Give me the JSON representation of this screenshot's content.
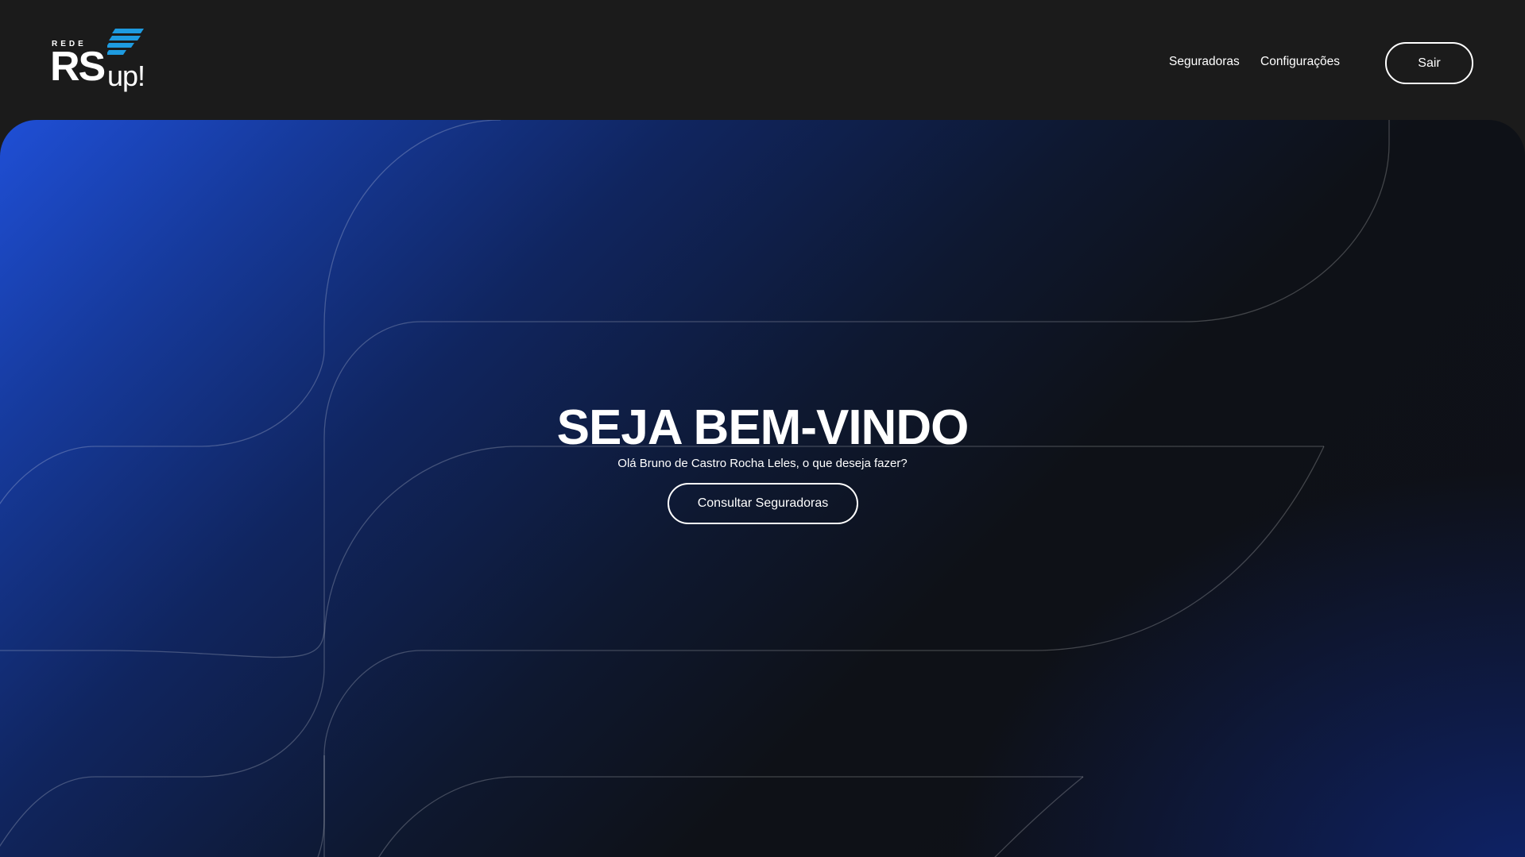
{
  "header": {
    "logo": {
      "small_text": "REDE",
      "main_text": "RS",
      "suffix_text": "up!",
      "mark_icon": "stacked-stripes-icon",
      "mark_color": "#1e9be0"
    },
    "nav": [
      {
        "label": "Seguradoras"
      },
      {
        "label": "Configurações"
      }
    ],
    "logout_label": "Sair"
  },
  "hero": {
    "title": "SEJA BEM-VINDO",
    "subtitle": "Olá Bruno de Castro Rocha Leles, o que deseja fazer?",
    "cta_label": "Consultar Seguradoras"
  },
  "colors": {
    "header_bg": "#1b1b1b",
    "hero_gradient_start": "#1f4fd6",
    "hero_gradient_mid": "#0e1117",
    "hero_gradient_end": "#0e246e",
    "text": "#ffffff"
  }
}
